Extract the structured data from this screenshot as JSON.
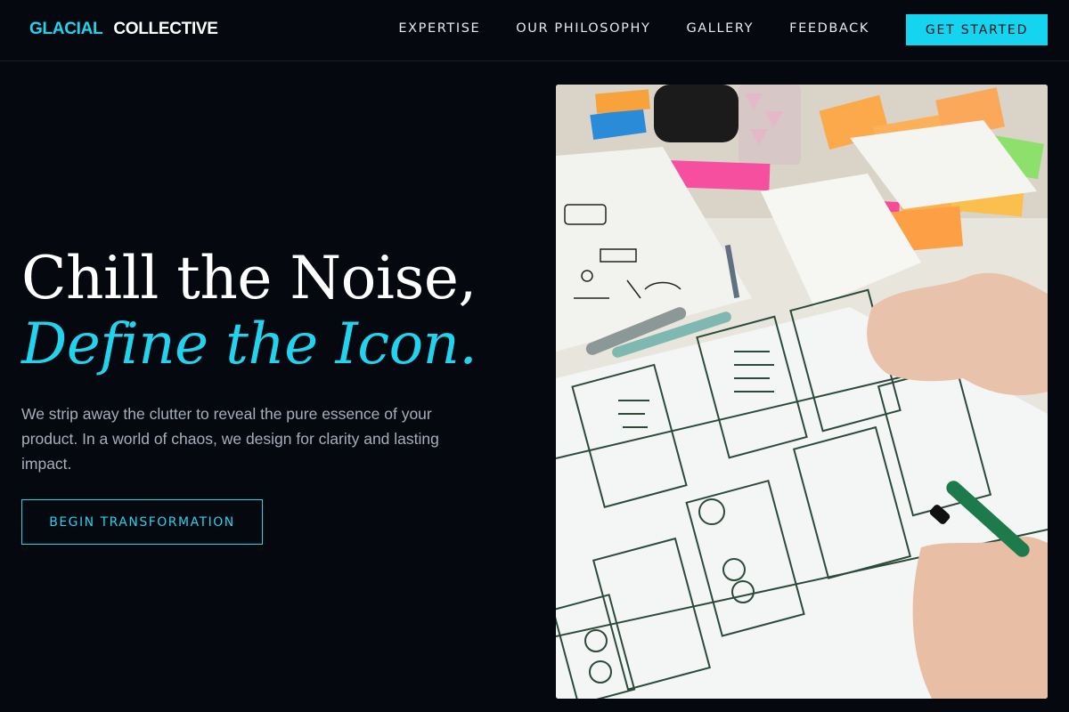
{
  "brand": {
    "part1": "GLACIAL",
    "part2": "COLLECTIVE"
  },
  "nav": {
    "items": [
      "EXPERTISE",
      "OUR PHILOSOPHY",
      "GALLERY",
      "FEEDBACK"
    ],
    "cta": "GET STARTED"
  },
  "hero": {
    "title_line1": "Chill the Noise,",
    "title_line2": "Define the Icon.",
    "description": "We strip away the clutter to reveal the pure essence of your product. In a world of chaos, we design for clarity and lasting impact.",
    "button": "BEGIN TRANSFORMATION",
    "image_alt": "Design team sketching app wireframes on paper"
  },
  "colors": {
    "accent": "#22d3ee",
    "background": "#05080f",
    "text_muted": "#a7aebb"
  }
}
